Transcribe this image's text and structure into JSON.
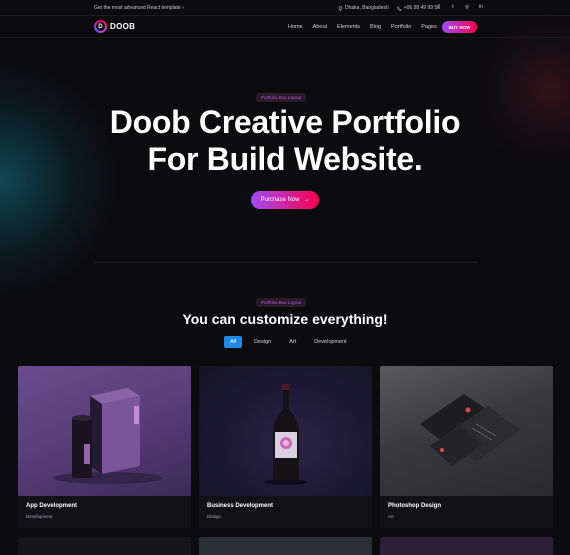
{
  "topbar": {
    "promo": "Get the most advanced React template",
    "location": "Dhaka, Bangladesh",
    "phone": "+06 58 49 99 56",
    "socials": [
      "facebook-icon",
      "twitter-icon",
      "instagram-icon",
      "linkedin-icon"
    ]
  },
  "header": {
    "logo": "DOOB",
    "logo_letter": "D",
    "nav": [
      "Home",
      "About",
      "Elements",
      "Blog",
      "Portfolio",
      "Pages"
    ],
    "cta": "BUY NOW"
  },
  "hero": {
    "badge": "Portfolio Box Layout",
    "title_line1": "Doob Creative Portfolio",
    "title_line2": "For Build Website.",
    "button": "Purchase Now"
  },
  "portfolio": {
    "badge": "Portfolio Box Layout",
    "title": "You can customize everything!",
    "filters": [
      "All",
      "Design",
      "Art",
      "Development"
    ],
    "active_filter": "All",
    "cards": [
      {
        "title": "App Development",
        "category": "Development"
      },
      {
        "title": "Business Development",
        "category": "Design"
      },
      {
        "title": "Photoshop Design",
        "category": "Art"
      }
    ]
  },
  "colors": {
    "accent_start": "#a14bf8",
    "accent_end": "#f9004d",
    "filter_active": "#1e8ae6",
    "background": "#0c0c0e"
  }
}
